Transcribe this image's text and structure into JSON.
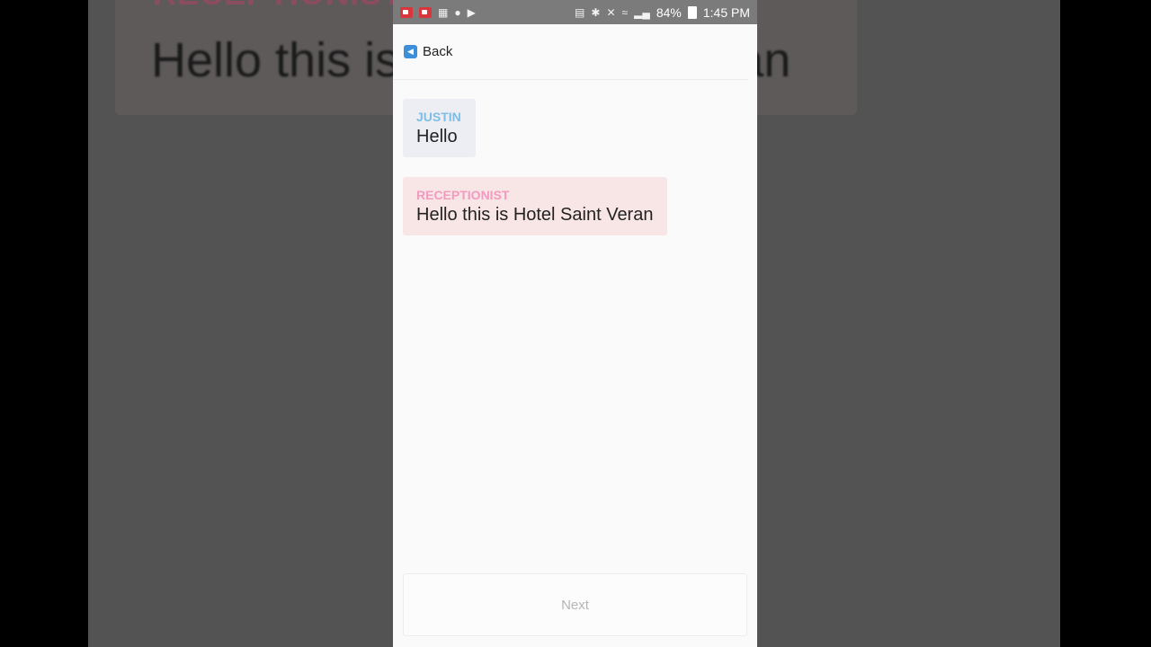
{
  "background": {
    "speaker": "RECEPTIONIST",
    "message": "Hello this is Hotel Saint Veran"
  },
  "statusbar": {
    "battery": "84%",
    "time": "1:45 PM"
  },
  "header": {
    "back_label": "Back"
  },
  "messages": [
    {
      "speaker": "JUSTIN",
      "text": "Hello"
    },
    {
      "speaker": "RECEPTIONIST",
      "text": "Hello this is Hotel Saint Veran"
    }
  ],
  "footer": {
    "next_label": "Next"
  },
  "colors": {
    "justin_name": "#7dbde6",
    "receptionist_name": "#f29ac0",
    "justin_bubble": "#eceef3",
    "receptionist_bubble": "#f8e6e6"
  }
}
